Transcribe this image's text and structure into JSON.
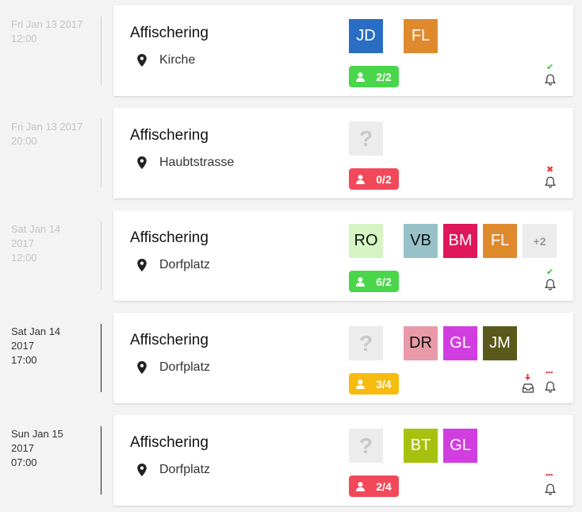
{
  "events": [
    {
      "date": [
        "Fri Jan 13 2017",
        "12:00"
      ],
      "past": true,
      "title": "Affischering",
      "location": "Kirche",
      "avatars": [
        {
          "initials": "JD",
          "bg": "#2a6ec4",
          "fg": "#ffffff",
          "col": 0
        },
        {
          "initials": "FL",
          "bg": "#e08a2e",
          "fg": "#ffffff",
          "col": 1
        }
      ],
      "badge": {
        "text": "2/2",
        "color": "#4ad64a"
      },
      "status": {
        "type": "check",
        "symbol": "✔",
        "color": "#3cc43c"
      },
      "icons": [
        "bell-icon"
      ]
    },
    {
      "date": [
        "Fri Jan 13 2017",
        "20:00"
      ],
      "past": true,
      "title": "Affischering",
      "location": "Haubtstrasse",
      "avatars": [
        {
          "initials": "?",
          "unknown": true,
          "col": 0
        }
      ],
      "badge": {
        "text": "0/2",
        "color": "#f2495a"
      },
      "status": {
        "type": "cross",
        "symbol": "✖",
        "color": "#e83a3a"
      },
      "icons": [
        "bell-icon"
      ]
    },
    {
      "date": [
        "Sat Jan 14",
        "2017",
        "12:00"
      ],
      "past": true,
      "title": "Affischering",
      "location": "Dorfplatz",
      "avatars": [
        {
          "initials": "RO",
          "bg": "#d6f3c4",
          "fg": "#111111",
          "col": 0
        },
        {
          "initials": "VB",
          "bg": "#97c2c9",
          "fg": "#111111",
          "col": 1
        },
        {
          "initials": "BM",
          "bg": "#e0175a",
          "fg": "#ffffff",
          "col": 2
        },
        {
          "initials": "FL",
          "bg": "#e08a2e",
          "fg": "#ffffff",
          "col": 3
        },
        {
          "initials": "+2",
          "more": true,
          "col": 4
        }
      ],
      "badge": {
        "text": "6/2",
        "color": "#4ad64a"
      },
      "status": {
        "type": "check",
        "symbol": "✔",
        "color": "#3cc43c"
      },
      "icons": [
        "bell-icon"
      ]
    },
    {
      "date": [
        "Sat Jan 14",
        "2017",
        "17:00"
      ],
      "past": false,
      "title": "Affischering",
      "location": "Dorfplatz",
      "avatars": [
        {
          "initials": "?",
          "unknown": true,
          "col": 0
        },
        {
          "initials": "DR",
          "bg": "#e89aa8",
          "fg": "#111111",
          "col": 1
        },
        {
          "initials": "GL",
          "bg": "#d13ee0",
          "fg": "#ffffff",
          "col": 2
        },
        {
          "initials": "JM",
          "bg": "#59591b",
          "fg": "#ffffff",
          "col": 3
        }
      ],
      "badge": {
        "text": "3/4",
        "color": "#f7bb0f"
      },
      "status": {
        "type": "dots",
        "symbol": "•••",
        "color": "#e83a3a"
      },
      "icons": [
        "inbox-icon",
        "bell-icon"
      ]
    },
    {
      "date": [
        "Sun Jan 15",
        "2017",
        "07:00"
      ],
      "past": false,
      "title": "Affischering",
      "location": "Dorfplatz",
      "avatars": [
        {
          "initials": "?",
          "unknown": true,
          "col": 0
        },
        {
          "initials": "BT",
          "bg": "#a6c20f",
          "fg": "#ffffff",
          "col": 1
        },
        {
          "initials": "GL",
          "bg": "#d13ee0",
          "fg": "#ffffff",
          "col": 2
        }
      ],
      "badge": {
        "text": "2/4",
        "color": "#f2495a"
      },
      "status": {
        "type": "dots",
        "symbol": "•••",
        "color": "#e83a3a"
      },
      "icons": [
        "bell-icon"
      ]
    }
  ]
}
